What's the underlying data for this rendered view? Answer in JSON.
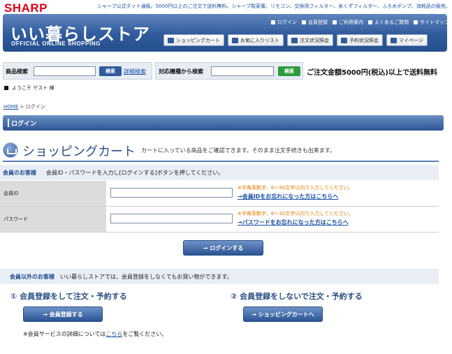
{
  "header": {
    "brand": "SHARP",
    "tagline": "シャープ公式ネット通販。5000円以上のご注文で送料無料。シャープ製家電、リモコン、交換用フィルター、糸くずフィルター、ふろ水ポンプ、消耗品の販売。",
    "store_name": "いい暮らしストア",
    "store_sub": "OFFICIAL ONLINE SHOPPING",
    "top_links": [
      "ログイン",
      "会員登録",
      "ご利用案内",
      "よくあるご質問",
      "サイトマップ"
    ],
    "nav_buttons": [
      "ショッピングカート",
      "お気に入りリスト",
      "注文状況照会",
      "予約状況照会",
      "マイページ"
    ]
  },
  "search": {
    "product_label": "商品検索",
    "product_button": "検索",
    "detail_link": "詳細検索",
    "model_label": "対応機種から検索",
    "model_button": "検索",
    "free_shipping": "ご注文金額5000円(税込)以上で送料無料"
  },
  "welcome": "ようこそ ゲスト 様",
  "breadcrumb": {
    "home": "HOME",
    "sep": ">",
    "current": "ログイン"
  },
  "page_bar": "ログイン",
  "cart": {
    "title": "ショッピングカート",
    "description": "カートに入っている商品をご確認できます。そのまま注文手続きも出来ます。"
  },
  "member": {
    "heading": "会員のお客様",
    "instruction": "会員ID・パスワードを入力し[ログインする]ボタンを押してください。",
    "id_label": "会員ID",
    "id_note": "※半角英数字、6～50文字以内で入力してください。",
    "id_forgot": "→会員IDをお忘れになった方はこちらへ",
    "pw_label": "パスワード",
    "pw_note": "※半角英数字、6～32文字以内で入力してください。",
    "pw_forgot": "→パスワードをお忘れになった方はこちらへ",
    "login_button": "→ ログインする"
  },
  "nonmember": {
    "heading": "会員以外のお客様",
    "description": "いい暮らしストアでは、会員登録をしなくてもお買い物ができます。",
    "option1": "① 会員登録をして注文・予約する",
    "option1_button": "→ 会員登録する",
    "option2": "② 会員登録をしないで注文・予約する",
    "option2_button": "→ ショッピングカートへ",
    "footnote_pre": "※会員サービスの詳細については",
    "footnote_link": "こちら",
    "footnote_post": "をご覧ください。"
  },
  "colors": {
    "brand_red": "#e0001a",
    "header_blue": "#2f5a9c",
    "search_button": "#2f5a9c",
    "model_button": "#2e9a3e",
    "note_orange": "#e87a00"
  }
}
